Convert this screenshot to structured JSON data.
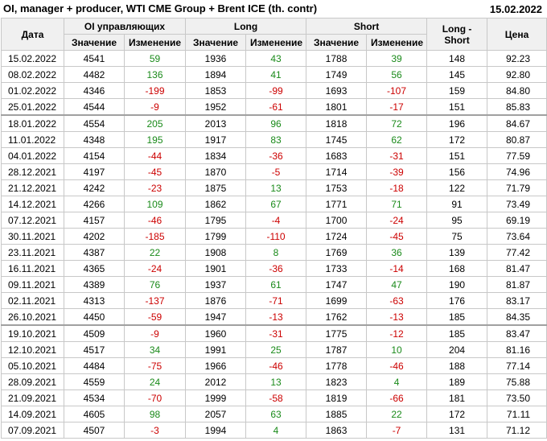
{
  "header": {
    "title": "OI, manager + producer, WTI CME Group + Brent ICE (th. contr)",
    "date": "15.02.2022"
  },
  "columns": {
    "date": "Дата",
    "oi_group": "OI управляющих",
    "long_group": "Long",
    "short_group": "Short",
    "long_short": "Long - Short",
    "price": "Цена",
    "value": "Значение",
    "change": "Изменение"
  },
  "rows": [
    {
      "date": "15.02.2022",
      "oi": "4541",
      "oi_ch": "59",
      "long": "1936",
      "long_ch": "43",
      "short": "1788",
      "short_ch": "39",
      "ls": "148",
      "price": "92.23"
    },
    {
      "date": "08.02.2022",
      "oi": "4482",
      "oi_ch": "136",
      "long": "1894",
      "long_ch": "41",
      "short": "1749",
      "short_ch": "56",
      "ls": "145",
      "price": "92.80"
    },
    {
      "date": "01.02.2022",
      "oi": "4346",
      "oi_ch": "-199",
      "long": "1853",
      "long_ch": "-99",
      "short": "1693",
      "short_ch": "-107",
      "ls": "159",
      "price": "84.80"
    },
    {
      "date": "25.01.2022",
      "oi": "4544",
      "oi_ch": "-9",
      "long": "1952",
      "long_ch": "-61",
      "short": "1801",
      "short_ch": "-17",
      "ls": "151",
      "price": "85.83"
    },
    {
      "date": "18.01.2022",
      "oi": "4554",
      "oi_ch": "205",
      "long": "2013",
      "long_ch": "96",
      "short": "1818",
      "short_ch": "72",
      "ls": "196",
      "price": "84.67"
    },
    {
      "date": "11.01.2022",
      "oi": "4348",
      "oi_ch": "195",
      "long": "1917",
      "long_ch": "83",
      "short": "1745",
      "short_ch": "62",
      "ls": "172",
      "price": "80.87"
    },
    {
      "date": "04.01.2022",
      "oi": "4154",
      "oi_ch": "-44",
      "long": "1834",
      "long_ch": "-36",
      "short": "1683",
      "short_ch": "-31",
      "ls": "151",
      "price": "77.59"
    },
    {
      "date": "28.12.2021",
      "oi": "4197",
      "oi_ch": "-45",
      "long": "1870",
      "long_ch": "-5",
      "short": "1714",
      "short_ch": "-39",
      "ls": "156",
      "price": "74.96"
    },
    {
      "date": "21.12.2021",
      "oi": "4242",
      "oi_ch": "-23",
      "long": "1875",
      "long_ch": "13",
      "short": "1753",
      "short_ch": "-18",
      "ls": "122",
      "price": "71.79"
    },
    {
      "date": "14.12.2021",
      "oi": "4266",
      "oi_ch": "109",
      "long": "1862",
      "long_ch": "67",
      "short": "1771",
      "short_ch": "71",
      "ls": "91",
      "price": "73.49"
    },
    {
      "date": "07.12.2021",
      "oi": "4157",
      "oi_ch": "-46",
      "long": "1795",
      "long_ch": "-4",
      "short": "1700",
      "short_ch": "-24",
      "ls": "95",
      "price": "69.19"
    },
    {
      "date": "30.11.2021",
      "oi": "4202",
      "oi_ch": "-185",
      "long": "1799",
      "long_ch": "-110",
      "short": "1724",
      "short_ch": "-45",
      "ls": "75",
      "price": "73.64"
    },
    {
      "date": "23.11.2021",
      "oi": "4387",
      "oi_ch": "22",
      "long": "1908",
      "long_ch": "8",
      "short": "1769",
      "short_ch": "36",
      "ls": "139",
      "price": "77.42"
    },
    {
      "date": "16.11.2021",
      "oi": "4365",
      "oi_ch": "-24",
      "long": "1901",
      "long_ch": "-36",
      "short": "1733",
      "short_ch": "-14",
      "ls": "168",
      "price": "81.47"
    },
    {
      "date": "09.11.2021",
      "oi": "4389",
      "oi_ch": "76",
      "long": "1937",
      "long_ch": "61",
      "short": "1747",
      "short_ch": "47",
      "ls": "190",
      "price": "81.87"
    },
    {
      "date": "02.11.2021",
      "oi": "4313",
      "oi_ch": "-137",
      "long": "1876",
      "long_ch": "-71",
      "short": "1699",
      "short_ch": "-63",
      "ls": "176",
      "price": "83.17"
    },
    {
      "date": "26.10.2021",
      "oi": "4450",
      "oi_ch": "-59",
      "long": "1947",
      "long_ch": "-13",
      "short": "1762",
      "short_ch": "-13",
      "ls": "185",
      "price": "84.35"
    },
    {
      "date": "19.10.2021",
      "oi": "4509",
      "oi_ch": "-9",
      "long": "1960",
      "long_ch": "-31",
      "short": "1775",
      "short_ch": "-12",
      "ls": "185",
      "price": "83.47"
    },
    {
      "date": "12.10.2021",
      "oi": "4517",
      "oi_ch": "34",
      "long": "1991",
      "long_ch": "25",
      "short": "1787",
      "short_ch": "10",
      "ls": "204",
      "price": "81.16"
    },
    {
      "date": "05.10.2021",
      "oi": "4484",
      "oi_ch": "-75",
      "long": "1966",
      "long_ch": "-46",
      "short": "1778",
      "short_ch": "-46",
      "ls": "188",
      "price": "77.14"
    },
    {
      "date": "28.09.2021",
      "oi": "4559",
      "oi_ch": "24",
      "long": "2012",
      "long_ch": "13",
      "short": "1823",
      "short_ch": "4",
      "ls": "189",
      "price": "75.88"
    },
    {
      "date": "21.09.2021",
      "oi": "4534",
      "oi_ch": "-70",
      "long": "1999",
      "long_ch": "-58",
      "short": "1819",
      "short_ch": "-66",
      "ls": "181",
      "price": "73.50"
    },
    {
      "date": "14.09.2021",
      "oi": "4605",
      "oi_ch": "98",
      "long": "2057",
      "long_ch": "63",
      "short": "1885",
      "short_ch": "22",
      "ls": "172",
      "price": "71.11"
    },
    {
      "date": "07.09.2021",
      "oi": "4507",
      "oi_ch": "-3",
      "long": "1994",
      "long_ch": "4",
      "short": "1863",
      "short_ch": "-7",
      "ls": "131",
      "price": "71.12"
    }
  ],
  "colors": {
    "positive": "#1a8a1a",
    "negative": "#cc0000"
  }
}
